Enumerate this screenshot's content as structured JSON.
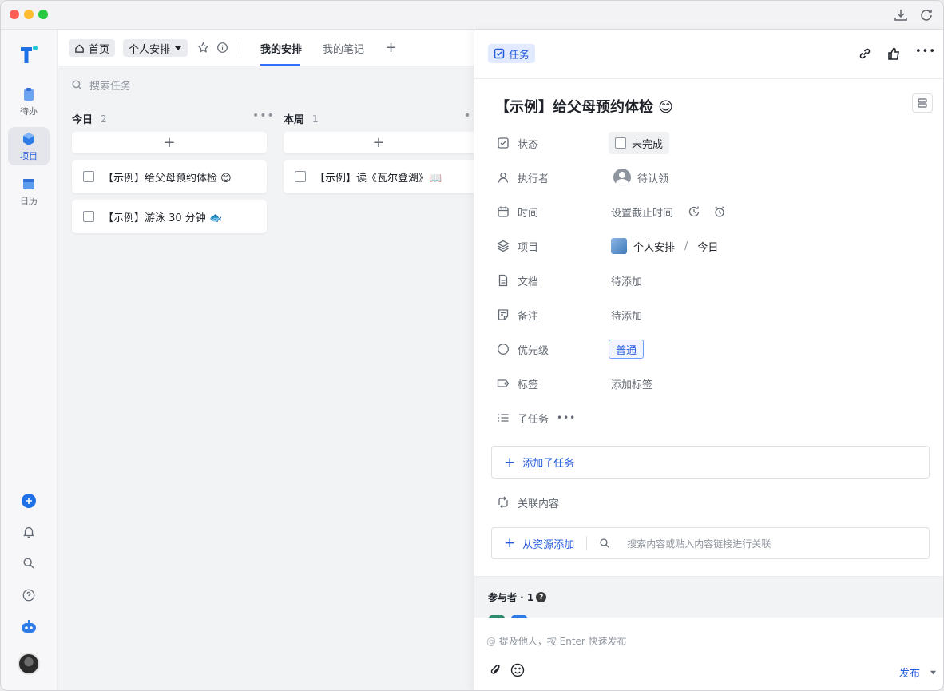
{
  "rail": {
    "items": [
      {
        "label": "待办"
      },
      {
        "label": "项目"
      },
      {
        "label": "日历"
      }
    ]
  },
  "topbar": {
    "home_label": "首页",
    "project_label": "个人安排",
    "tabs": [
      {
        "label": "我的安排"
      },
      {
        "label": "我的笔记"
      }
    ]
  },
  "search": {
    "placeholder": "搜索任务"
  },
  "columns": [
    {
      "title": "今日",
      "count": "2",
      "cards": [
        {
          "title": "【示例】给父母预约体检 😊"
        },
        {
          "title": "【示例】游泳 30 分钟 🐟"
        }
      ]
    },
    {
      "title": "本周",
      "count": "1",
      "cards": [
        {
          "title": "【示例】读《瓦尔登湖》📖"
        }
      ]
    }
  ],
  "detail": {
    "tag_label": "任务",
    "title": "【示例】给父母预约体检 😊",
    "fields": {
      "status": {
        "label": "状态",
        "value": "未完成"
      },
      "assignee": {
        "label": "执行者",
        "value": "待认领"
      },
      "time": {
        "label": "时间",
        "value": "设置截止时间"
      },
      "project": {
        "label": "项目",
        "value": "个人安排",
        "separator": "/",
        "section": "今日"
      },
      "doc": {
        "label": "文档",
        "value": "待添加"
      },
      "note": {
        "label": "备注",
        "value": "待添加"
      },
      "priority": {
        "label": "优先级",
        "value": "普通"
      },
      "tags": {
        "label": "标签",
        "value": "添加标签"
      },
      "subtasks": {
        "label": "子任务"
      }
    },
    "add_subtask": "添加子任务",
    "related": {
      "label": "关联内容",
      "add_from_resource": "从资源添加",
      "search_placeholder": "搜索内容或贴入内容链接进行关联"
    },
    "participants": {
      "label": "参与者 · 1"
    },
    "comment": {
      "placeholder": "提及他人，按 Enter 快速发布",
      "publish": "发布"
    }
  },
  "colors": {
    "accent": "#3370ff",
    "accent_text": "#245bdb",
    "tag_bg": "#e1eaff"
  }
}
